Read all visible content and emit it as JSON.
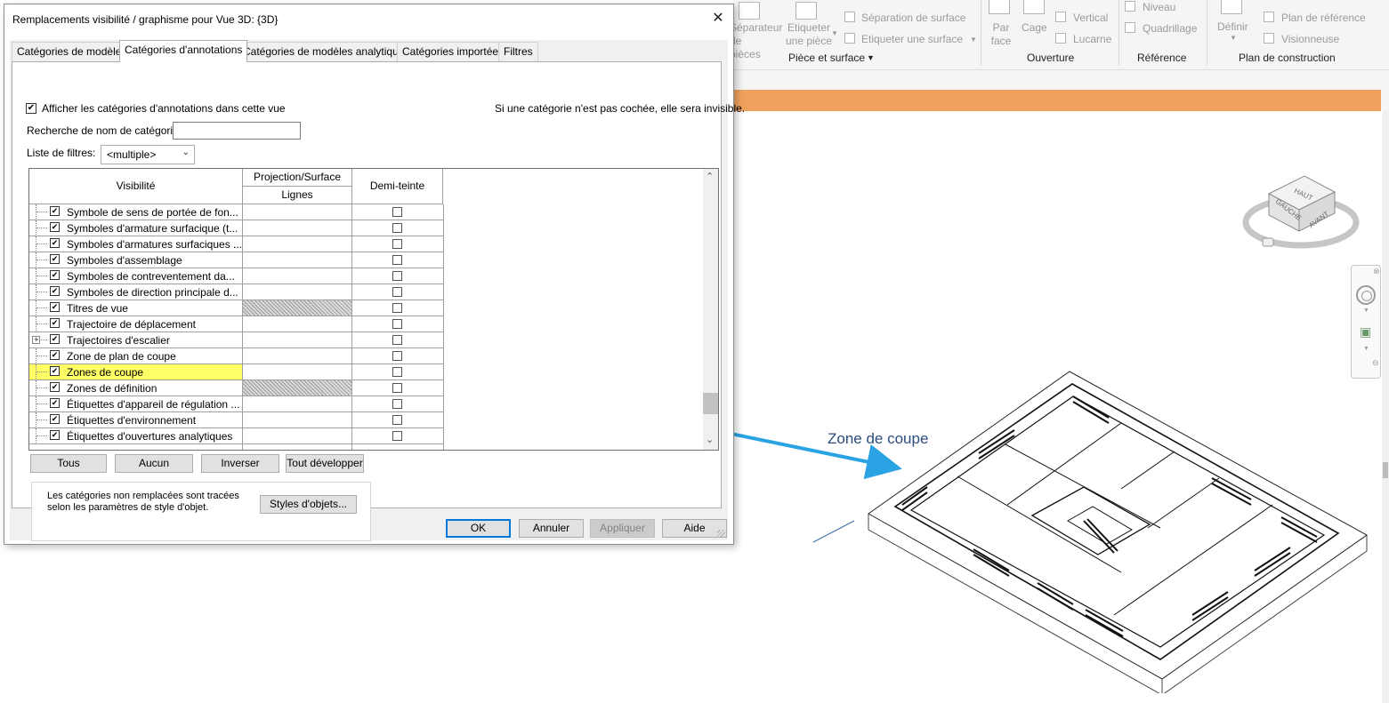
{
  "ribbon": {
    "items": [
      "Séparateur de pièces",
      "Etiqueter une pièce",
      "Séparation  de surface",
      "Etiqueter  une surface",
      "Par face",
      "Cage",
      "Vertical",
      "Lucarne",
      "Niveau",
      "Quadrillage",
      "Définir",
      "Plan de référence",
      "Visionneuse"
    ],
    "groups": [
      "Pièce et surface",
      "Ouverture",
      "Référence",
      "Plan de construction"
    ]
  },
  "viewcube": {
    "top": "HAUT",
    "left": "GAUCHE",
    "front": "AVANT"
  },
  "annotation": {
    "label": "Zone de coupe",
    "color": "#29a3e3"
  },
  "dialog": {
    "title": "Remplacements visibilité / graphisme pour Vue 3D: {3D}",
    "close": "✕",
    "tabs": [
      "Catégories de modèles",
      "Catégories d'annotations",
      "Catégories de modèles analytiques",
      "Catégories importées",
      "Filtres"
    ],
    "active_tab": "Catégories d'annotations",
    "show_label": "Afficher les catégories d'annotations dans cette vue",
    "hint": "Si une catégorie n'est pas cochée, elle sera invisible.",
    "search_label": "Recherche de nom de catégorie:",
    "search_value": "",
    "filter_label": "Liste de filtres:",
    "filter_value": "<multiple>",
    "columns": {
      "visibility": "Visibilité",
      "projection": "Projection/Surface",
      "lines": "Lignes",
      "halftone": "Demi-teinte"
    },
    "rows": [
      {
        "label": "Symbole de sens de portée de fon...",
        "checked": true,
        "hatch": false,
        "expander": false,
        "highlight": false
      },
      {
        "label": "Symboles d'armature surfacique (t...",
        "checked": true,
        "hatch": false,
        "expander": false,
        "highlight": false
      },
      {
        "label": "Symboles d'armatures surfaciques ...",
        "checked": true,
        "hatch": false,
        "expander": false,
        "highlight": false
      },
      {
        "label": "Symboles d'assemblage",
        "checked": true,
        "hatch": false,
        "expander": false,
        "highlight": false
      },
      {
        "label": "Symboles de contreventement da...",
        "checked": true,
        "hatch": false,
        "expander": false,
        "highlight": false
      },
      {
        "label": "Symboles de direction principale d...",
        "checked": true,
        "hatch": false,
        "expander": false,
        "highlight": false
      },
      {
        "label": "Titres de vue",
        "checked": true,
        "hatch": true,
        "expander": false,
        "highlight": false
      },
      {
        "label": "Trajectoire de déplacement",
        "checked": true,
        "hatch": false,
        "expander": false,
        "highlight": false
      },
      {
        "label": "Trajectoires d'escalier",
        "checked": true,
        "hatch": false,
        "expander": true,
        "highlight": false
      },
      {
        "label": "Zone de plan de coupe",
        "checked": true,
        "hatch": false,
        "expander": false,
        "highlight": false
      },
      {
        "label": "Zones de coupe",
        "checked": true,
        "hatch": false,
        "expander": false,
        "highlight": true
      },
      {
        "label": "Zones de définition",
        "checked": true,
        "hatch": true,
        "expander": false,
        "highlight": false
      },
      {
        "label": "Étiquettes d'appareil de régulation ...",
        "checked": true,
        "hatch": false,
        "expander": false,
        "highlight": false
      },
      {
        "label": "Étiquettes d'environnement",
        "checked": true,
        "hatch": false,
        "expander": false,
        "highlight": false
      },
      {
        "label": "Étiquettes d'ouvertures analytiques",
        "checked": true,
        "hatch": false,
        "expander": false,
        "highlight": false
      }
    ],
    "buttons": {
      "all": "Tous",
      "none": "Aucun",
      "invert": "Inverser",
      "expand": "Tout développer"
    },
    "info": "Les catégories non remplacées sont tracées selon les paramètres de style d'objet.",
    "object_styles": "Styles d'objets...",
    "footer": {
      "ok": "OK",
      "cancel": "Annuler",
      "apply": "Appliquer",
      "help": "Aide"
    }
  }
}
